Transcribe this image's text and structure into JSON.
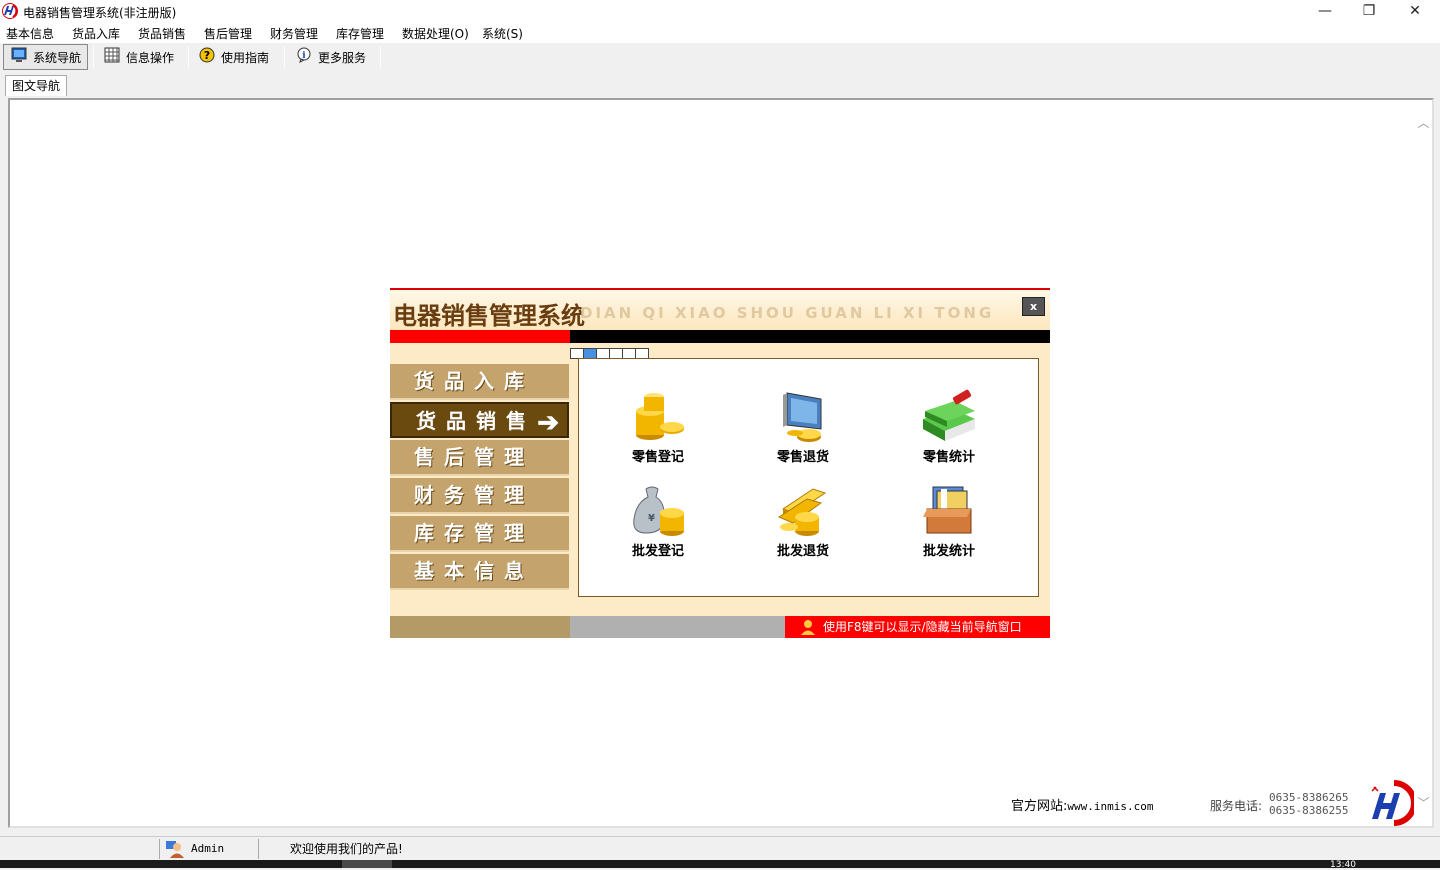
{
  "window": {
    "title": "电器销售管理系统(非注册版)",
    "minimize": "—",
    "maximize": "❐",
    "close": "✕"
  },
  "menu": [
    "基本信息",
    "货品入库",
    "货品销售",
    "售后管理",
    "财务管理",
    "库存管理",
    "数据处理(O)",
    "系统(S)"
  ],
  "toolbar": {
    "nav": "系统导航",
    "info": "信息操作",
    "guide": "使用指南",
    "more": "更多服务"
  },
  "tab": "图文导航",
  "nav_dialog": {
    "title": "电器销售管理系统",
    "pinyin": "DIAN QI XIAO SHOU GUAN LI XI TONG",
    "close": "x",
    "side": [
      "货品入库",
      "货品销售",
      "售后管理",
      "财务管理",
      "库存管理",
      "基本信息"
    ],
    "active_index": 1,
    "functions": {
      "retail_register": "零售登记",
      "retail_return": "零售退货",
      "retail_stats": "零售统计",
      "wholesale_register": "批发登记",
      "wholesale_return": "批发退货",
      "wholesale_stats": "批发统计"
    },
    "tip": "使用F8键可以显示/隐藏当前导航窗口"
  },
  "footer": {
    "site_label": "官方网站:",
    "site_url": "www.inmis.com",
    "phone_label": "服务电话:",
    "phone1": "0635-8386265",
    "phone2": "0635-8386255"
  },
  "status": {
    "user": "Admin",
    "message": "欢迎使用我们的产品!"
  },
  "taskbar": {
    "clock": "13:40"
  },
  "colors": {
    "accent_red": "#ff0000",
    "nav_brown": "#6b4a10",
    "nav_tan": "#c4a46c"
  }
}
